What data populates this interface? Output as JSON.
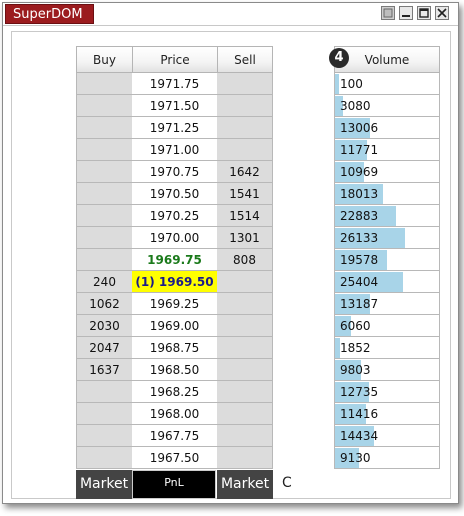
{
  "window": {
    "title": "SuperDOM"
  },
  "ladder": {
    "headers": {
      "buy": "Buy",
      "price": "Price",
      "sell": "Sell"
    },
    "rows": [
      {
        "buy": "",
        "price": "1971.75",
        "sell": ""
      },
      {
        "buy": "",
        "price": "1971.50",
        "sell": ""
      },
      {
        "buy": "",
        "price": "1971.25",
        "sell": ""
      },
      {
        "buy": "",
        "price": "1971.00",
        "sell": ""
      },
      {
        "buy": "",
        "price": "1970.75",
        "sell": "1642"
      },
      {
        "buy": "",
        "price": "1970.50",
        "sell": "1541"
      },
      {
        "buy": "",
        "price": "1970.25",
        "sell": "1514"
      },
      {
        "buy": "",
        "price": "1970.00",
        "sell": "1301"
      },
      {
        "buy": "",
        "price": "1969.75",
        "sell": "808",
        "state": "last"
      },
      {
        "buy": "240",
        "price": "(1) 1969.50",
        "sell": "",
        "state": "position"
      },
      {
        "buy": "1062",
        "price": "1969.25",
        "sell": ""
      },
      {
        "buy": "2030",
        "price": "1969.00",
        "sell": ""
      },
      {
        "buy": "2047",
        "price": "1968.75",
        "sell": ""
      },
      {
        "buy": "1637",
        "price": "1968.50",
        "sell": ""
      },
      {
        "buy": "",
        "price": "1968.25",
        "sell": ""
      },
      {
        "buy": "",
        "price": "1968.00",
        "sell": ""
      },
      {
        "buy": "",
        "price": "1967.75",
        "sell": ""
      },
      {
        "buy": "",
        "price": "1967.50",
        "sell": ""
      }
    ],
    "footer": {
      "buy_market": "Market",
      "pnl": "PnL",
      "sell_market": "Market",
      "extra": "C"
    }
  },
  "volume": {
    "badge": "4",
    "header": "Volume",
    "max": 26133,
    "rows": [
      100,
      3080,
      13006,
      11771,
      10969,
      18013,
      22883,
      26133,
      19578,
      25404,
      13187,
      6060,
      1852,
      9803,
      12735,
      11416,
      14434,
      9130
    ]
  },
  "colors": {
    "title_bg": "#9b1b1e",
    "last_price": "#1b7a1b",
    "position_highlight": "#ffff00",
    "volume_bar": "#a8d4e8",
    "market_button": "#444444",
    "pnl_button": "#000000"
  }
}
